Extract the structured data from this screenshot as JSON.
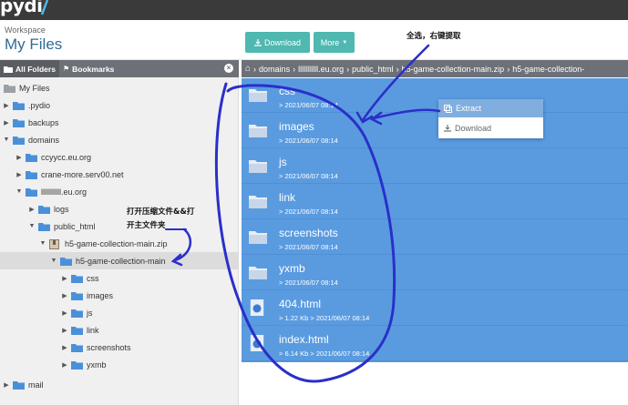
{
  "topbar": {
    "logo": "pydi"
  },
  "header": {
    "workspace_label": "Workspace",
    "workspace_title": "My Files",
    "download_label": "Download",
    "more_label": "More"
  },
  "sidebar": {
    "tab_all_folders": "All Folders",
    "tab_bookmarks": "Bookmarks",
    "tree": [
      {
        "label": "My Files"
      },
      {
        "label": ".pydio"
      },
      {
        "label": "backups"
      },
      {
        "label": "domains"
      },
      {
        "label": "ccyycc.eu.org"
      },
      {
        "label": "crane-more.serv00.net"
      },
      {
        "label": "lllllllllll.eu.org"
      },
      {
        "label": "logs"
      },
      {
        "label": "public_html"
      },
      {
        "label": "h5-game-collection-main.zip"
      },
      {
        "label": "h5-game-collection-main"
      },
      {
        "label": "css"
      },
      {
        "label": "images"
      },
      {
        "label": "js"
      },
      {
        "label": "link"
      },
      {
        "label": "screenshots"
      },
      {
        "label": "yxmb"
      },
      {
        "label": "mail"
      }
    ]
  },
  "breadcrumb": {
    "items": [
      "domains",
      "lllllllllll.eu.org",
      "public_html",
      "h5-game-collection-main.zip",
      "h5-game-collection-"
    ]
  },
  "files": [
    {
      "name": "css",
      "meta": "2021/06/07 08:14"
    },
    {
      "name": "images",
      "meta": "2021/06/07 08:14"
    },
    {
      "name": "js",
      "meta": "2021/06/07 08:14"
    },
    {
      "name": "link",
      "meta": "2021/06/07 08:14"
    },
    {
      "name": "screenshots",
      "meta": "2021/06/07 08:14"
    },
    {
      "name": "yxmb",
      "meta": "2021/06/07 08:14"
    },
    {
      "name": "404.html",
      "meta": "1.22 Kb  >  2021/06/07 08:14"
    },
    {
      "name": "index.html",
      "meta": "6.14 Kb  >  2021/06/07 08:14"
    }
  ],
  "context_menu": {
    "extract_label": "Extract",
    "download_label": "Download"
  },
  "annotations": {
    "top_note": "全选，右键提取",
    "side_note_line1": "打开压缩文件&&打",
    "side_note_line2": "开主文件夹"
  },
  "colors": {
    "selection": "#5a9be0",
    "accent": "#4fb8b0",
    "toolbar": "#6d7177",
    "pen": "#2a2fc9"
  }
}
